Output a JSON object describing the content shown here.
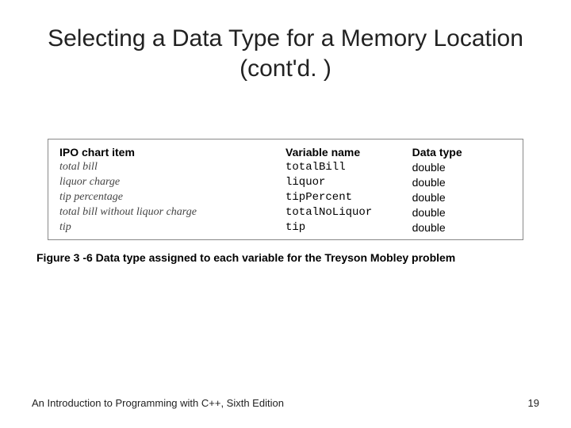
{
  "title": "Selecting a Data Type for a Memory Location (cont'd. )",
  "table": {
    "headers": {
      "item": "IPO chart item",
      "var": "Variable name",
      "type": "Data type"
    },
    "rows": [
      {
        "item": "total bill",
        "var": "totalBill",
        "type": "double"
      },
      {
        "item": "liquor charge",
        "var": "liquor",
        "type": "double"
      },
      {
        "item": "tip percentage",
        "var": "tipPercent",
        "type": "double"
      },
      {
        "item": "total bill without liquor charge",
        "var": "totalNoLiquor",
        "type": "double"
      },
      {
        "item": "tip",
        "var": "tip",
        "type": "double"
      }
    ]
  },
  "caption": "Figure 3 -6 Data type assigned to each variable for the Treyson Mobley problem",
  "footer": {
    "book": "An Introduction to Programming with C++, Sixth Edition",
    "page": "19"
  }
}
